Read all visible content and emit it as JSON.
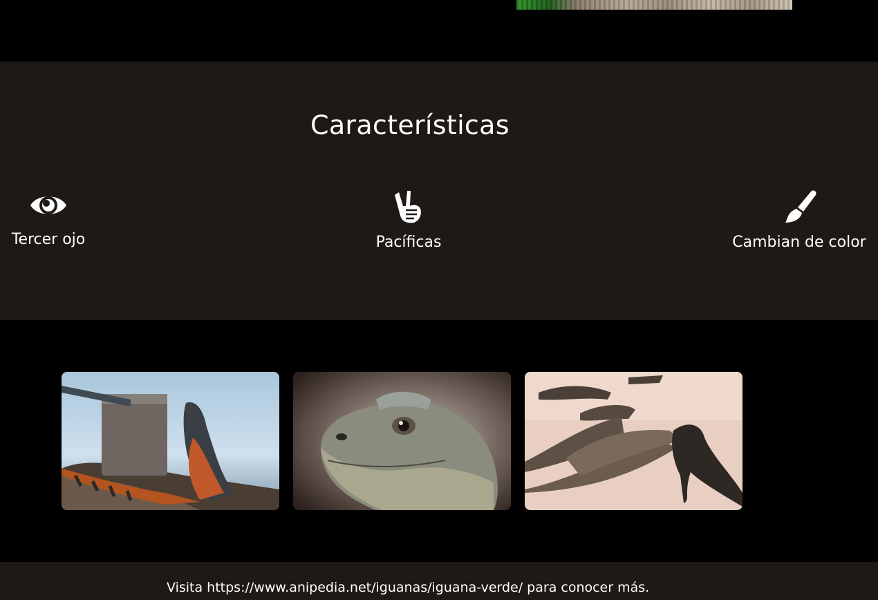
{
  "features": {
    "title": "Características",
    "items": [
      {
        "label": "Tercer ojo",
        "icon": "eye-icon"
      },
      {
        "label": "Pacíficas",
        "icon": "peace-hand-icon"
      },
      {
        "label": "Cambian de color",
        "icon": "paintbrush-icon"
      }
    ]
  },
  "gallery": {
    "photos": [
      {
        "subject": "orange-iguana-by-water"
      },
      {
        "subject": "iguana-head-closeup"
      },
      {
        "subject": "iguanas-on-sand"
      }
    ]
  },
  "footer": {
    "text": "Visita https://www.anipedia.net/iguanas/iguana-verde/ para conocer más."
  },
  "colors": {
    "background": "#000000",
    "section": "#1e1915",
    "text": "#ffffff"
  }
}
